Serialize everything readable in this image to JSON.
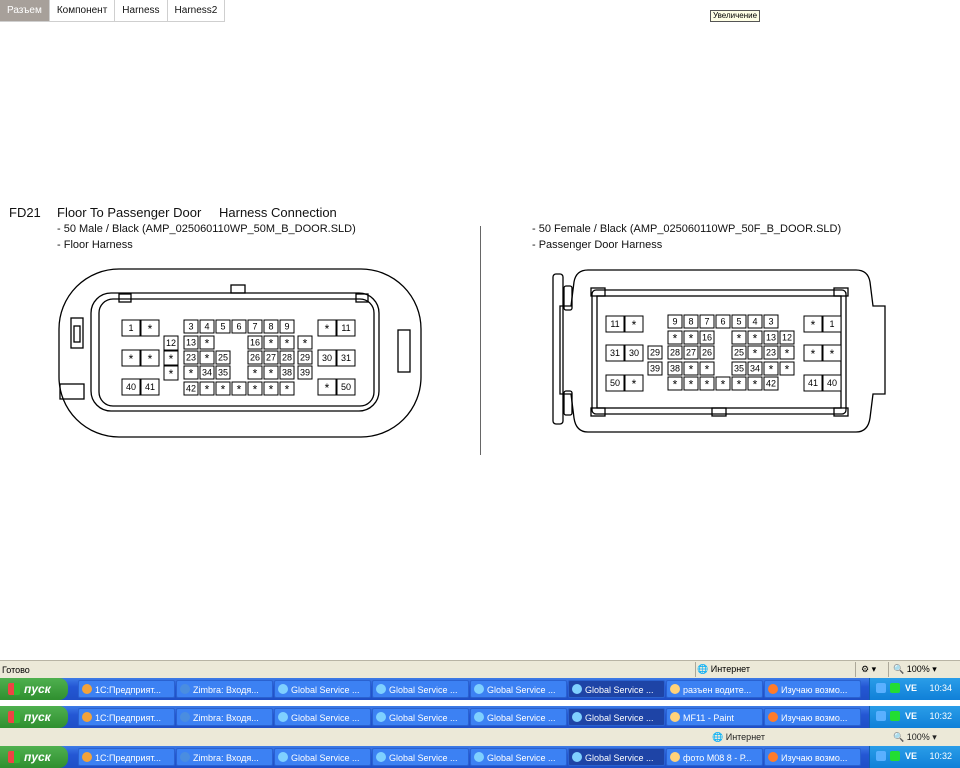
{
  "tabs": [
    {
      "label": "Разъем",
      "active": true
    },
    {
      "label": "Компонент",
      "active": false
    },
    {
      "label": "Harness",
      "active": false
    },
    {
      "label": "Harness2",
      "active": false
    }
  ],
  "tooltip": "Увеличение",
  "connector": {
    "code": "FD21",
    "title": "Floor To Passenger Door",
    "subtitle": "Harness Connection",
    "left": {
      "spec": "- 50 Male / Black (AMP_025060110WP_50M_B_DOOR.SLD)",
      "harness": "- Floor Harness"
    },
    "right": {
      "spec": "- 50 Female / Black (AMP_025060110WP_50F_B_DOOR.SLD)",
      "harness": "- Passenger Door Harness"
    }
  },
  "status": {
    "text": "Готово",
    "zone": "Интернет",
    "zoom": "100%"
  },
  "taskbar1": {
    "start": "пуск",
    "time": "10:34",
    "lang": "VE",
    "items": [
      "1С:Предприят...",
      "Zimbra: Входя...",
      "Global Service ...",
      "Global Service ...",
      "Global Service ...",
      "Global Service ...",
      "разъен водите...",
      "Изучаю возмо..."
    ]
  },
  "taskbar2": {
    "start": "пуск",
    "time": "10:32",
    "lang": "VE",
    "items": [
      "1С:Предприят...",
      "Zimbra: Входя...",
      "Global Service ...",
      "Global Service ...",
      "Global Service ...",
      "Global Service ...",
      "MF11 - Paint",
      "Изучаю возмо..."
    ]
  },
  "taskbar3": {
    "start": "пуск",
    "time": "10:32",
    "lang": "VE",
    "zone": "Интернет",
    "zoom": "100%",
    "items": [
      "1С:Предприят...",
      "Zimbra: Входя...",
      "Global Service ...",
      "Global Service ...",
      "Global Service ...",
      "Global Service ...",
      "фото М08 8 - Р...",
      "Изучаю возмо..."
    ]
  },
  "pins_left": [
    [
      "1",
      0
    ],
    [
      "*",
      0
    ],
    [
      "*",
      0
    ],
    [
      "*",
      0
    ],
    [
      "40",
      0
    ],
    [
      "41",
      0
    ],
    [
      "12",
      0
    ],
    [
      "*",
      0
    ],
    [
      "*",
      0
    ],
    [
      "3",
      0
    ],
    [
      "4",
      0
    ],
    [
      "5",
      0
    ],
    [
      "6",
      0
    ],
    [
      "7",
      0
    ],
    [
      "8",
      0
    ],
    [
      "9",
      0
    ],
    [
      "13",
      0
    ],
    [
      "*",
      0
    ],
    [
      "16",
      0
    ],
    [
      "*",
      0
    ],
    [
      "*",
      0
    ],
    [
      "*",
      0
    ],
    [
      "23",
      0
    ],
    [
      "*",
      0
    ],
    [
      "25",
      0
    ],
    [
      "26",
      0
    ],
    [
      "27",
      0
    ],
    [
      "28",
      0
    ],
    [
      "29",
      0
    ],
    [
      "*",
      0
    ],
    [
      "34",
      0
    ],
    [
      "35",
      0
    ],
    [
      "*",
      0
    ],
    [
      "*",
      0
    ],
    [
      "38",
      0
    ],
    [
      "39",
      0
    ],
    [
      "42",
      0
    ],
    [
      "*",
      0
    ],
    [
      "*",
      0
    ],
    [
      "*",
      0
    ],
    [
      "*",
      0
    ],
    [
      "*",
      0
    ],
    [
      "*",
      0
    ],
    [
      "*",
      0
    ],
    [
      "11",
      0
    ],
    [
      "30",
      0
    ],
    [
      "31",
      0
    ],
    [
      "*",
      0
    ],
    [
      "50",
      0
    ]
  ],
  "pins_right": [
    [
      "11",
      0
    ],
    [
      "*",
      0
    ],
    [
      "31",
      0
    ],
    [
      "30",
      0
    ],
    [
      "50",
      0
    ],
    [
      "*",
      0
    ],
    [
      "9",
      0
    ],
    [
      "8",
      0
    ],
    [
      "7",
      0
    ],
    [
      "6",
      0
    ],
    [
      "5",
      0
    ],
    [
      "4",
      0
    ],
    [
      "3",
      0
    ],
    [
      "*",
      0
    ],
    [
      "*",
      0
    ],
    [
      "16",
      0
    ],
    [
      "*",
      0
    ],
    [
      "*",
      0
    ],
    [
      "13",
      0
    ],
    [
      "12",
      0
    ],
    [
      "29",
      0
    ],
    [
      "28",
      0
    ],
    [
      "27",
      0
    ],
    [
      "26",
      0
    ],
    [
      "25",
      0
    ],
    [
      "*",
      0
    ],
    [
      "23",
      0
    ],
    [
      "*",
      0
    ],
    [
      "39",
      0
    ],
    [
      "38",
      0
    ],
    [
      "*",
      0
    ],
    [
      "*",
      0
    ],
    [
      "35",
      0
    ],
    [
      "34",
      0
    ],
    [
      "*",
      0
    ],
    [
      "*",
      0
    ],
    [
      "*",
      0
    ],
    [
      "*",
      0
    ],
    [
      "*",
      0
    ],
    [
      "*",
      0
    ],
    [
      "*",
      0
    ],
    [
      "*",
      0
    ],
    [
      "42",
      0
    ],
    [
      "*",
      0
    ],
    [
      "1",
      0
    ],
    [
      "*",
      0
    ],
    [
      "*",
      0
    ],
    [
      "41",
      0
    ],
    [
      "40",
      0
    ]
  ]
}
